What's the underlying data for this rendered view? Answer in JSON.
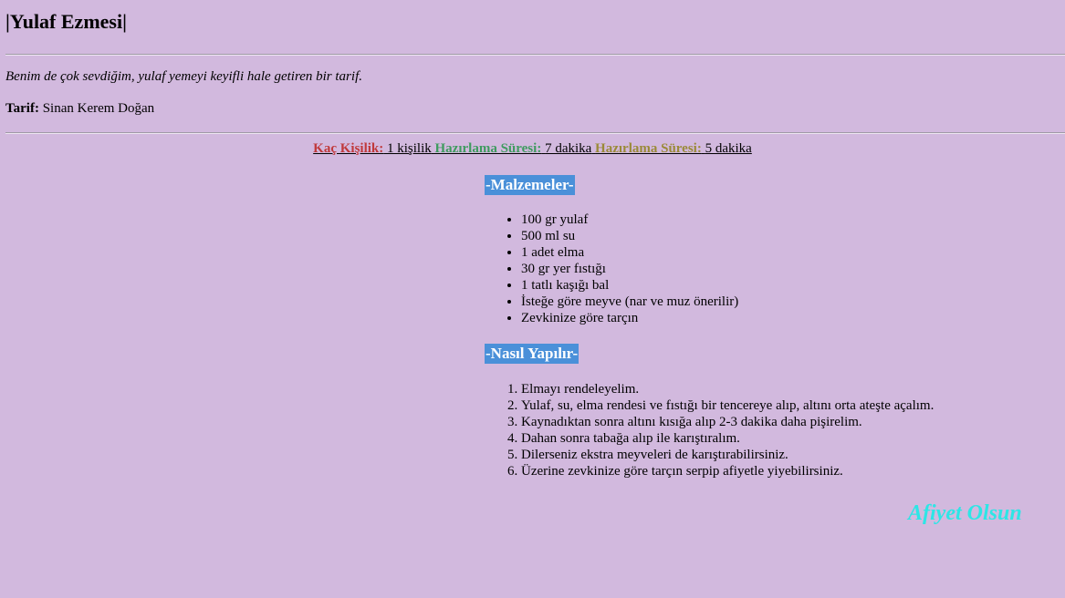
{
  "header": {
    "title": "|Yulaf Ezmesi|",
    "description": "Benim de çok sevdiğim, yulaf yemeyi keyifli hale getiren bir tarif.",
    "author_label": "Tarif:",
    "author_name": "Sinan Kerem Doğan"
  },
  "meta": {
    "servings_label": "Kaç Kişilik:",
    "servings_value": "1 kişilik",
    "prep_label": "Hazırlama Süresi:",
    "prep_value": "7 dakika",
    "prep2_label": "Hazırlama Süresi:",
    "prep2_value": "5 dakika"
  },
  "ingredients": {
    "heading": "-Malzemeler-",
    "items": [
      "100 gr yulaf",
      "500 ml su",
      "1 adet elma",
      "30 gr yer fıstığı",
      "1 tatlı kaşığı bal",
      "İsteğe göre meyve (nar ve muz önerilir)",
      "Zevkinize göre tarçın"
    ]
  },
  "steps": {
    "heading": "-Nasıl Yapılır-",
    "items": [
      "Elmayı rendeleyelim.",
      "Yulaf, su, elma rendesi ve fıstığı bir tencereye alıp, altını orta ateşte açalım.",
      "Kaynadıktan sonra altını kısığa alıp 2-3 dakika daha pişirelim.",
      "Dahan sonra tabağa alıp ile karıştıralım.",
      "Dilerseniz ekstra meyveleri de karıştırabilirsiniz.",
      "Üzerine zevkinize göre tarçın serpip afiyetle yiyebilirsiniz."
    ]
  },
  "closing": "Afiyet Olsun",
  "colors": {
    "background": "#d2b9de",
    "servings_label": "#c0393b",
    "prep_label": "#3f9b5f",
    "prep2_label": "#9a8a37",
    "section_heading_bg": "#4a90d9",
    "closing": "#2de6e6"
  }
}
